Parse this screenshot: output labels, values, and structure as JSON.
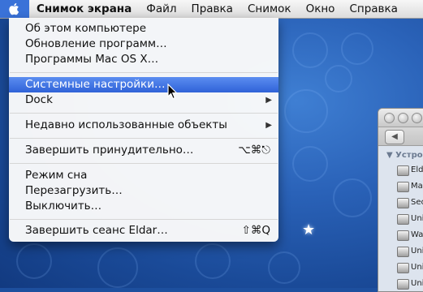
{
  "menubar": {
    "app_name": "Снимок экрана",
    "menus": [
      "Файл",
      "Правка",
      "Снимок",
      "Окно",
      "Справка"
    ]
  },
  "apple_menu": {
    "items": [
      {
        "label": "Об этом компьютере",
        "shortcut": "",
        "submenu": false
      },
      {
        "label": "Обновление программ…",
        "shortcut": "",
        "submenu": false
      },
      {
        "label": "Программы Mac OS X…",
        "shortcut": "",
        "submenu": false
      },
      {
        "label": "Системные настройки…",
        "shortcut": "",
        "submenu": false,
        "highlighted": true
      },
      {
        "label": "Dock",
        "shortcut": "",
        "submenu": true
      },
      {
        "label": "Недавно использованные объекты",
        "shortcut": "",
        "submenu": true
      },
      {
        "label": "Завершить принудительно…",
        "shortcut": "⌥⌘⎋",
        "submenu": false
      },
      {
        "label": "Режим сна",
        "shortcut": "",
        "submenu": false
      },
      {
        "label": "Перезагрузить…",
        "shortcut": "",
        "submenu": false
      },
      {
        "label": "Выключить…",
        "shortcut": "",
        "submenu": false
      },
      {
        "label": "Завершить сеанс Eldar…",
        "shortcut": "⇧⌘Q",
        "submenu": false
      }
    ]
  },
  "finder": {
    "section": "▼ Устро",
    "devices": [
      "Eld",
      "Ma",
      "Sec",
      "Uni",
      "Wa",
      "Uni",
      "Uni",
      "Uni"
    ]
  },
  "colors": {
    "highlight": "#2f62d8",
    "desktop": "#1d4f9e"
  }
}
